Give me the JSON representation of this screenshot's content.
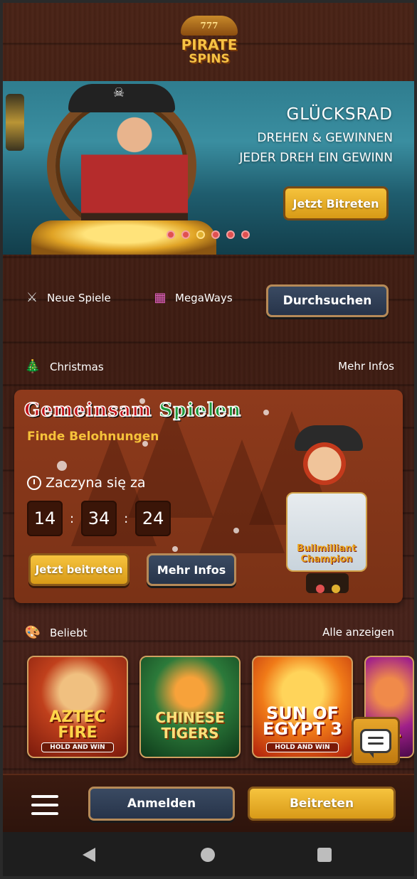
{
  "header": {
    "logo_number": "777",
    "logo_line1": "PIRATE",
    "logo_line2": "SPINS"
  },
  "hero": {
    "title": "GLÜCKSRAD",
    "line2": "DREHEN & GEWINNEN",
    "line3": "JEDER DREH EIN GEWINN",
    "cta": "Jetzt Bitreten",
    "active_dot_index": 2,
    "dot_count": 6
  },
  "quicknav": {
    "new_games": "Neue Spiele",
    "megaways": "MegaWays",
    "search": "Durchsuchen"
  },
  "christmas_section": {
    "title": "Christmas",
    "more": "Mehr Infos"
  },
  "promo": {
    "title_part1": "Gemeinsam",
    "title_part2": "Spielen",
    "subtitle": "Finde Belohnungen",
    "starts_label": "Zaczyna się za",
    "timer": {
      "hours": "14",
      "minutes": "34",
      "seconds": "24",
      "sep": ":"
    },
    "join": "Jetzt beitreten",
    "info": "Mehr Infos",
    "image_text": "Bullmilliant Champion"
  },
  "popular": {
    "title": "Beliebt",
    "all": "Alle anzeigen",
    "games": [
      {
        "title": "AZTEC FIRE",
        "sub": "HOLD AND WIN"
      },
      {
        "title": "CHINESE TIGERS",
        "sub": ""
      },
      {
        "title": "SUN OF EGYPT 3",
        "sub": "HOLD AND WIN"
      },
      {
        "title": "DR..",
        "sub": ""
      }
    ]
  },
  "bottombar": {
    "login": "Anmelden",
    "join": "Beitreten"
  },
  "colors": {
    "gold": "#f6c43e",
    "dark_button": "#2f3d55",
    "wood": "#4a2316",
    "accent_red": "#e05050"
  },
  "icons": [
    "menu-icon",
    "chat-icon",
    "crossed-swords-icon",
    "grid-icon",
    "tree-icon",
    "paint-icon",
    "clock-icon",
    "back-icon",
    "home-icon",
    "recents-icon"
  ]
}
